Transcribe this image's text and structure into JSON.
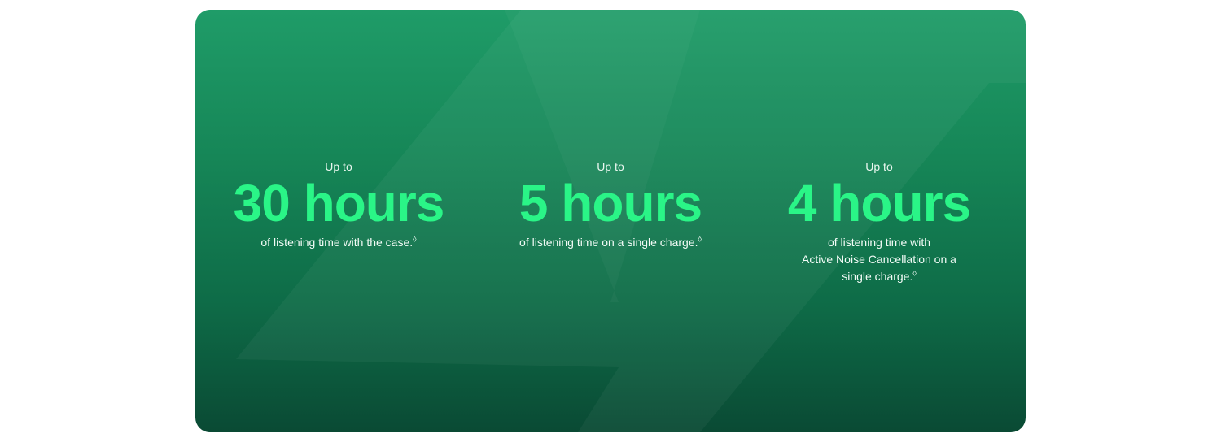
{
  "stats": [
    {
      "lead": "Up to",
      "value": "30 hours",
      "description": "of listening time with the case.",
      "footnote_mark": "◊"
    },
    {
      "lead": "Up to",
      "value": "5 hours",
      "description": "of listening time on a single charge.",
      "footnote_mark": "◊"
    },
    {
      "lead": "Up to",
      "value": "4 hours",
      "description_lines": [
        "of listening time with",
        "Active Noise Cancellation on a",
        "single charge."
      ],
      "footnote_mark": "◊"
    }
  ],
  "colors": {
    "accent": "#2af587",
    "card_top": "#1f9c68",
    "card_bottom": "#0a4a34"
  }
}
